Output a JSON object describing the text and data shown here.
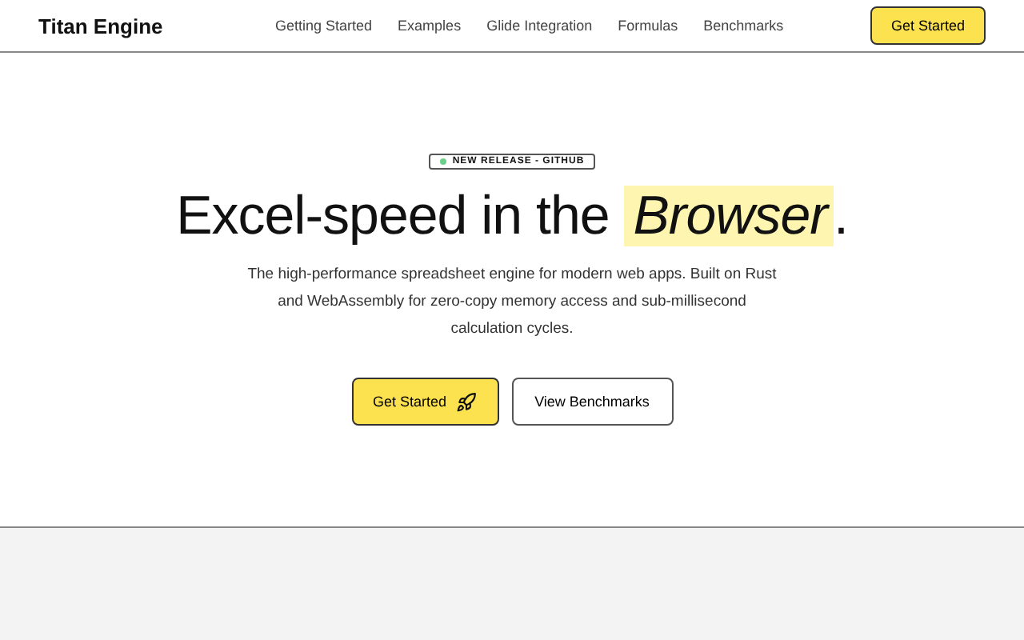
{
  "nav": {
    "brand": "Titan Engine",
    "links": [
      "Getting Started",
      "Examples",
      "Glide Integration",
      "Formulas",
      "Benchmarks"
    ],
    "cta": "Get Started"
  },
  "hero": {
    "badge": "NEW RELEASE - GITHUB",
    "headline": "Excel-speed in the *Browser*.",
    "description": "The high-performance spreadsheet engine for modern web apps. Built on Rust and WebAssembly for zero-copy memory access and sub-millisecond calculation cycles.",
    "buttons": [
      {
        "label": "Get Started",
        "kind": "primary"
      },
      {
        "label": "View Benchmarks",
        "kind": "secondary"
      }
    ]
  }
}
